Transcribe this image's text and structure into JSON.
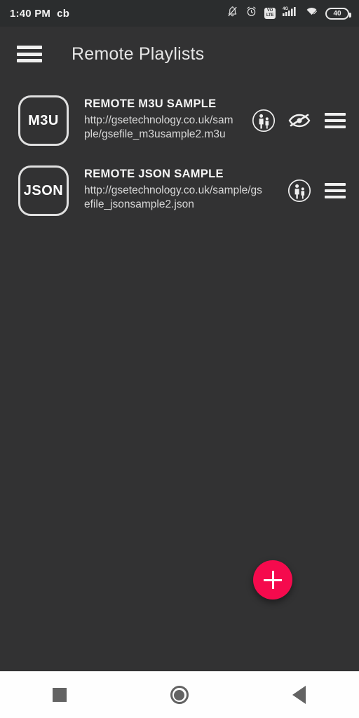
{
  "statusbar": {
    "clock": "1:40 PM",
    "carrier_label": "cb",
    "battery_level": "40",
    "network_type": "4G",
    "volte_line1": "VO",
    "volte_line2": "LTE",
    "icons": [
      "bell-muted-icon",
      "alarm-clock-icon",
      "volte-icon",
      "signal-bars-icon",
      "wifi-icon",
      "battery-icon"
    ]
  },
  "appbar": {
    "menu_icon": "hamburger-menu-icon",
    "title": "Remote Playlists"
  },
  "playlists": [
    {
      "badge": "M3U",
      "title": "REMOTE M3U SAMPLE",
      "url": "http://gsetechnology.co.uk/sample/gsefile_m3usample2.m3u",
      "actions": [
        "parental-control-icon",
        "hidden-eye-icon",
        "overflow-menu-icon"
      ]
    },
    {
      "badge": "JSON",
      "title": "REMOTE JSON SAMPLE",
      "url": "http://gsetechnology.co.uk/sample/gsefile_jsonsample2.json",
      "actions": [
        "parental-control-icon",
        "overflow-menu-icon"
      ]
    }
  ],
  "fab": {
    "label": "+",
    "name": "add-playlist-button",
    "color": "#f50a4d"
  },
  "navbar": {
    "recents_label": "recents",
    "home_label": "home",
    "back_label": "back"
  },
  "colors": {
    "app_background": "#323233",
    "statusbar_background": "#2b2d2e",
    "accent": "#f50a4d",
    "text_primary": "#f4f4f4",
    "text_secondary": "#d8d8d8",
    "navbar_background": "#fefefe"
  }
}
